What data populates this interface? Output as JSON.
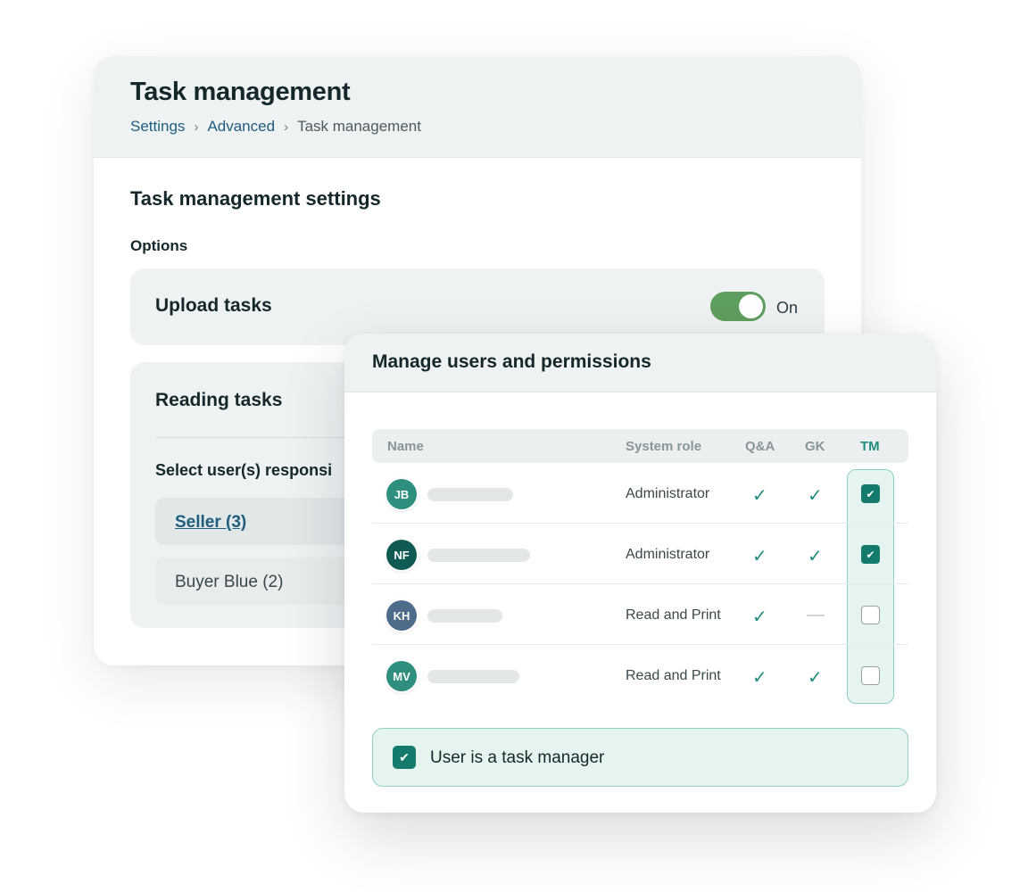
{
  "back": {
    "title": "Task management",
    "breadcrumb": {
      "item1": "Settings",
      "item2": "Advanced",
      "current": "Task management",
      "separator": "›"
    },
    "section_title": "Task management settings",
    "options_label": "Options",
    "upload": {
      "label": "Upload tasks",
      "toggle_state": "On"
    },
    "reading": {
      "label": "Reading tasks",
      "select_label": "Select user(s) responsi",
      "pills": [
        "Seller (3)",
        "Buyer Blue (2)"
      ]
    }
  },
  "front": {
    "title": "Manage users and permissions",
    "columns": {
      "name": "Name",
      "role": "System role",
      "qa": "Q&A",
      "gk": "GK",
      "tm": "TM"
    },
    "check_glyph": "✓",
    "checkbox_glyph": "✔",
    "rows": [
      {
        "initials": "JB",
        "avatar_color": "#2f8f7f",
        "role": "Administrator",
        "qa": true,
        "gk": true,
        "tm": true
      },
      {
        "initials": "NF",
        "avatar_color": "#0f5a52",
        "role": "Administrator",
        "qa": true,
        "gk": true,
        "tm": true
      },
      {
        "initials": "KH",
        "avatar_color": "#4f6b8a",
        "role": "Read and Print",
        "qa": true,
        "gk": false,
        "tm": false
      },
      {
        "initials": "MV",
        "avatar_color": "#2f8f7f",
        "role": "Read and Print",
        "qa": true,
        "gk": true,
        "tm": false
      }
    ],
    "banner": {
      "label": "User is a task manager",
      "checked": true
    }
  },
  "colors": {
    "accent": "#137a6c",
    "toggle_on": "#5e9e5e",
    "link": "#1e5d7e"
  }
}
